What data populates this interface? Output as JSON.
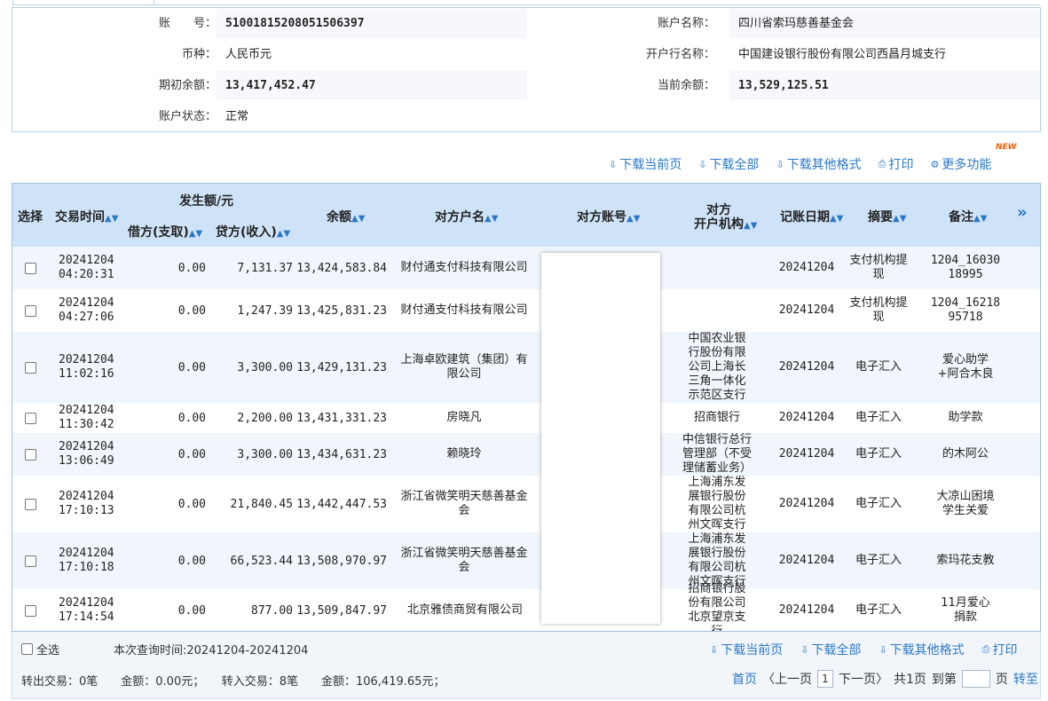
{
  "account": {
    "acct_no_label": "账　　号：",
    "acct_no": "51001815208051506397",
    "acct_name_label": "账户名称：",
    "acct_name": "四川省索玛慈善基金会",
    "currency_label": "币种：",
    "currency": "人民币元",
    "bank_label": "开户行名称：",
    "bank": "中国建设银行股份有限公司西昌月城支行",
    "opening_label": "期初余额：",
    "opening": "13,417,452.47",
    "current_label": "当前余额：",
    "current": "13,529,125.51",
    "status_label": "账户状态：",
    "status": "正常"
  },
  "toolbar": {
    "new_badge": "NEW",
    "download_current": "下载当前页",
    "download_all": "下载全部",
    "download_other": "下载其他格式",
    "print": "打印",
    "more": "更多功能"
  },
  "table": {
    "headers": {
      "select": "选择",
      "time": "交易时间",
      "amount_group": "发生额/元",
      "debit": "借方(支取)",
      "credit": "贷方(收入)",
      "balance": "余额",
      "counter_name": "对方户名",
      "counter_acct": "对方账号",
      "counter_bank_1": "对方",
      "counter_bank_2": "开户机构",
      "post_date": "记账日期",
      "summary": "摘要",
      "remark": "备注"
    },
    "rows": [
      {
        "date": "20241204",
        "time": "04:20:31",
        "debit": "0.00",
        "credit": "7,131.37",
        "balance": "13,424,583.84",
        "name": "财付通支付科技有限公司",
        "bank": "",
        "post": "20241204",
        "summary": "支付机构提现",
        "remark": "1204_16030 18995"
      },
      {
        "date": "20241204",
        "time": "04:27:06",
        "debit": "0.00",
        "credit": "1,247.39",
        "balance": "13,425,831.23",
        "name": "财付通支付科技有限公司",
        "bank": "",
        "post": "20241204",
        "summary": "支付机构提现",
        "remark": "1204_16218 95718"
      },
      {
        "date": "20241204",
        "time": "11:02:16",
        "debit": "0.00",
        "credit": "3,300.00",
        "balance": "13,429,131.23",
        "name": "上海卓欧建筑（集团）有限公司",
        "bank": "中国农业银行股份有限公司上海长三角一体化示范区支行",
        "post": "20241204",
        "summary": "电子汇入",
        "remark": "爱心助学+阿合木良"
      },
      {
        "date": "20241204",
        "time": "11:30:42",
        "debit": "0.00",
        "credit": "2,200.00",
        "balance": "13,431,331.23",
        "name": "房晓凡",
        "bank": "招商银行",
        "post": "20241204",
        "summary": "电子汇入",
        "remark": "助学款"
      },
      {
        "date": "20241204",
        "time": "13:06:49",
        "debit": "0.00",
        "credit": "3,300.00",
        "balance": "13,434,631.23",
        "name": "赖晓玲",
        "bank": "中信银行总行管理部（不受理储蓄业务）",
        "post": "20241204",
        "summary": "电子汇入",
        "remark": "的木阿公"
      },
      {
        "date": "20241204",
        "time": "17:10:13",
        "debit": "0.00",
        "credit": "21,840.45",
        "balance": "13,442,447.53",
        "name": "浙江省微笑明天慈善基金会",
        "bank": "上海浦东发展银行股份有限公司杭州文晖支行",
        "post": "20241204",
        "summary": "电子汇入",
        "remark": "大凉山困境学生关爱"
      },
      {
        "date": "20241204",
        "time": "17:10:18",
        "debit": "0.00",
        "credit": "66,523.44",
        "balance": "13,508,970.97",
        "name": "浙江省微笑明天慈善基金会",
        "bank": "上海浦东发展银行股份有限公司杭州文晖支行",
        "post": "20241204",
        "summary": "电子汇入",
        "remark": "索玛花支教"
      },
      {
        "date": "20241204",
        "time": "17:14:54",
        "debit": "0.00",
        "credit": "877.00",
        "balance": "13,509,847.97",
        "name": "北京雅债商贸有限公司",
        "bank": "招商银行股份有限公司北京望京支行",
        "post": "20241204",
        "summary": "电子汇入",
        "remark": "11月爱心捐款"
      }
    ]
  },
  "footer": {
    "select_all": "全选",
    "query_time": "本次查询时间:20241204-20241204",
    "download_current": "下载当前页",
    "download_all": "下载全部",
    "download_other": "下载其他格式",
    "print": "打印",
    "summary": "转出交易：0笔　　金额：0.00元；　　转入交易：8笔　　金额：106,419.65元；",
    "first": "首页",
    "prev": "〈上一页",
    "page": "1",
    "next": "下一页〉",
    "total": "共1页",
    "goto_label": "到第",
    "page_unit": "页",
    "goto": "转至"
  }
}
